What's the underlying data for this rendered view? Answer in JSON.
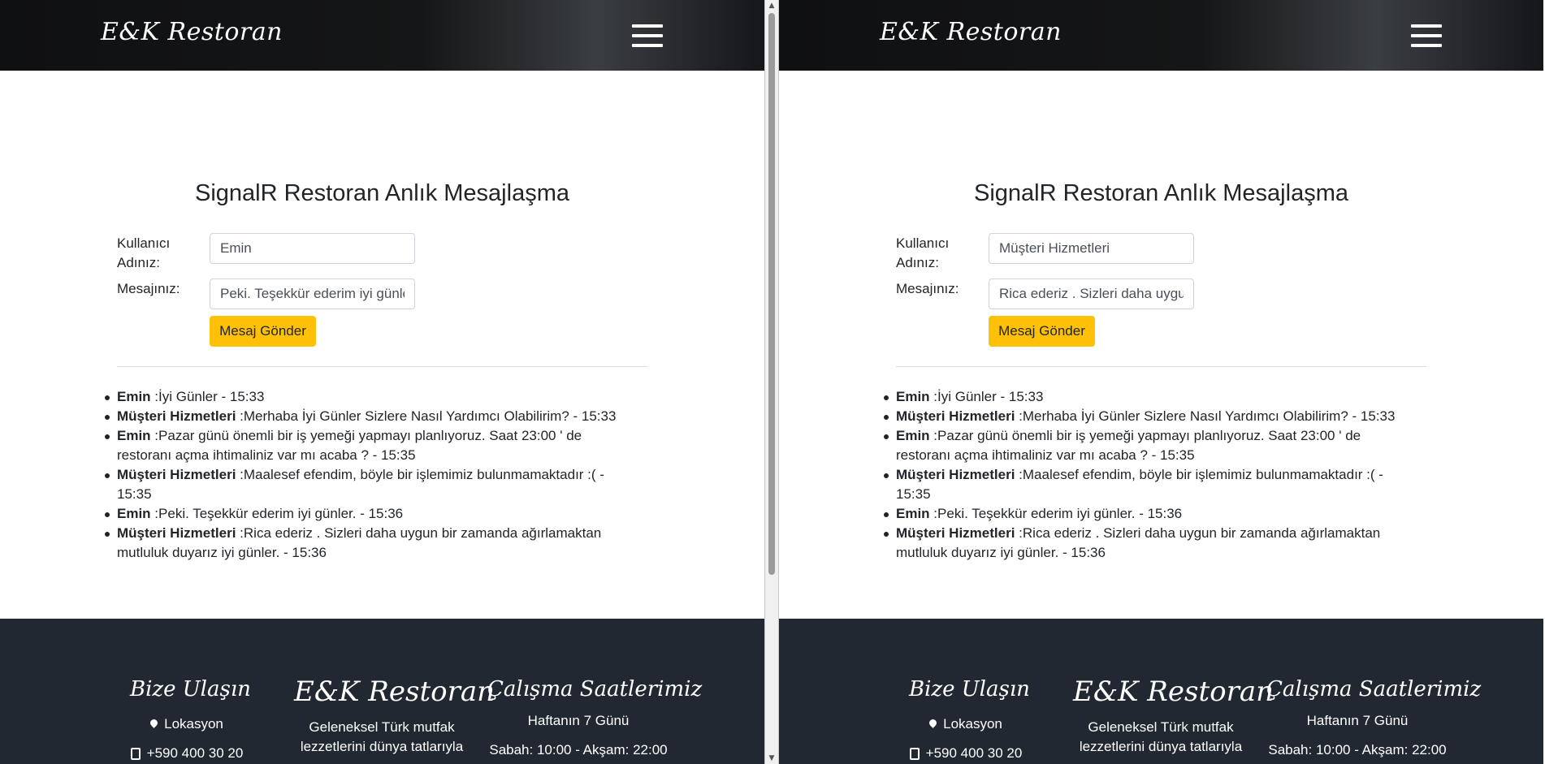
{
  "navbar": {
    "brand": "E&K Restoran"
  },
  "page": {
    "title": "SignalR Restoran Anlık Mesajlaşma"
  },
  "form": {
    "username_label": "Kullanıcı Adınız:",
    "message_label": "Mesajınız:",
    "send_label": "Mesaj Gönder"
  },
  "panes": [
    {
      "username_value": "Emin",
      "message_value": "Peki. Teşekkür ederim iyi günler."
    },
    {
      "username_value": "Müşteri Hizmetleri",
      "message_value": "Rica ederiz . Sizleri daha uygun bir zamanda"
    }
  ],
  "messages": [
    {
      "sender": "Emin",
      "text": ":İyi Günler - 15:33"
    },
    {
      "sender": "Müşteri Hizmetleri",
      "text": ":Merhaba İyi Günler Sizlere Nasıl Yardımcı Olabilirim? - 15:33"
    },
    {
      "sender": "Emin",
      "text": ":Pazar günü önemli bir iş yemeği yapmayı planlıyoruz. Saat 23:00 ' de restoranı açma ihtimaliniz var mı acaba ? - 15:35"
    },
    {
      "sender": "Müşteri Hizmetleri",
      "text": ":Maalesef efendim, böyle bir işlemimiz bulunmamaktadır :( - 15:35"
    },
    {
      "sender": "Emin",
      "text": ":Peki. Teşekkür ederim iyi günler. - 15:36"
    },
    {
      "sender": "Müşteri Hizmetleri",
      "text": ":Rica ederiz . Sizleri daha uygun bir zamanda ağırlamaktan mutluluk duyarız iyi günler. - 15:36"
    }
  ],
  "footer": {
    "contact_title": "Bize Ulaşın",
    "location": "Lokasyon",
    "phone": "+590 400 30 20",
    "brand": "E&K Restoran",
    "description": "Geleneksel Türk mutfak lezzetlerini dünya tatlarıyla",
    "hours_title": "Çalışma Saatlerimiz",
    "hours_days": "Haftanın 7 Günü",
    "hours_time": "Sabah: 10:00 - Akşam: 22:00"
  },
  "colors": {
    "accent": "#ffc107",
    "footer_bg": "#222831",
    "navbar_bg": "#151617"
  }
}
